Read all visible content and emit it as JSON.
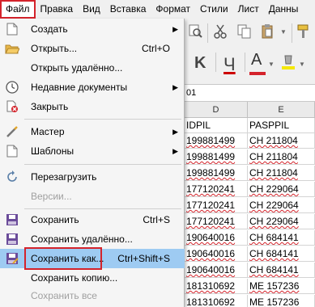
{
  "menubar": {
    "items": [
      "Файл",
      "Правка",
      "Вид",
      "Вставка",
      "Формат",
      "Стили",
      "Лист",
      "Данны"
    ]
  },
  "formula": {
    "value": "01"
  },
  "grid": {
    "col_letters": [
      "D",
      "E"
    ],
    "col_names": [
      "IDPIL",
      "PASPPIL"
    ],
    "rows": [
      [
        "199881499",
        "CH 211804"
      ],
      [
        "199881499",
        "CH 211804"
      ],
      [
        "199881499",
        "CH 211804"
      ],
      [
        "177120241",
        "CH 229064"
      ],
      [
        "177120241",
        "CH 229064"
      ],
      [
        "177120241",
        "CH 229064"
      ],
      [
        "190640016",
        "CH 684141"
      ],
      [
        "190640016",
        "CH 684141"
      ],
      [
        "190640016",
        "CH 684141"
      ],
      [
        "181310692",
        "ME 157236"
      ],
      [
        "181310692",
        "ME 157236"
      ]
    ]
  },
  "menu": {
    "items": [
      {
        "label": "Создать",
        "shortcut": "",
        "submenu": true,
        "icon": "new-document-icon"
      },
      {
        "label": "Открыть...",
        "shortcut": "Ctrl+O",
        "submenu": false,
        "icon": "open-folder-icon"
      },
      {
        "label": "Открыть удалённо...",
        "shortcut": "",
        "submenu": false,
        "icon": "remote-open-icon"
      },
      {
        "label": "Недавние документы",
        "shortcut": "",
        "submenu": true,
        "icon": "recent-clock-icon"
      },
      {
        "label": "Закрыть",
        "shortcut": "",
        "submenu": false,
        "icon": "close-document-icon"
      },
      {
        "label": "Мастер",
        "shortcut": "",
        "submenu": true,
        "icon": "wizard-wand-icon"
      },
      {
        "label": "Шаблоны",
        "shortcut": "",
        "submenu": true,
        "icon": "templates-icon"
      },
      {
        "label": "Перезагрузить",
        "shortcut": "",
        "submenu": false,
        "icon": "reload-icon"
      },
      {
        "label": "Версии...",
        "shortcut": "",
        "submenu": false,
        "icon": ""
      },
      {
        "label": "Сохранить",
        "shortcut": "Ctrl+S",
        "submenu": false,
        "icon": "save-icon"
      },
      {
        "label": "Сохранить удалённо...",
        "shortcut": "",
        "submenu": false,
        "icon": "save-remote-icon"
      },
      {
        "label": "Сохранить как...",
        "shortcut": "Ctrl+Shift+S",
        "submenu": false,
        "icon": "save-as-icon"
      },
      {
        "label": "Сохранить копию...",
        "shortcut": "",
        "submenu": false,
        "icon": ""
      },
      {
        "label": "Сохранить все",
        "shortcut": "",
        "submenu": false,
        "icon": ""
      }
    ]
  },
  "colors": {
    "highlight": "#9ecbf2",
    "annotation_red": "#d4232b"
  }
}
